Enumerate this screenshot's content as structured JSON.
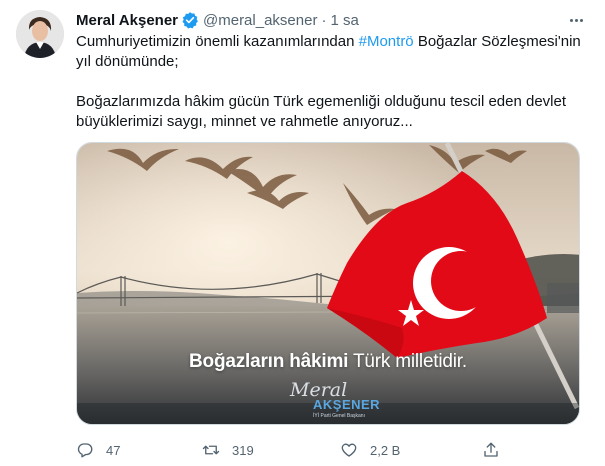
{
  "tweet": {
    "author_name": "Meral Akşener",
    "handle": "@meral_aksener",
    "separator": "·",
    "time": "1 sa",
    "text_before_hashtag": "Cumhuriyetimizin önemli kazanımlarından ",
    "hashtag": "#Montrö",
    "text_after_hashtag": " Boğazlar Sözleşmesi'nin yıl dönümünde;",
    "paragraph2": "Boğazlarımızda hâkim gücün Türk egemenliği olduğunu tescil eden devlet büyüklerimizi saygı, minnet ve rahmetle anıyoruz..."
  },
  "media": {
    "caption_bold": "Boğazların hâkimi",
    "caption_rest": " Türk milletidir.",
    "logo_script": "Meral",
    "logo_name": "AKŞENER",
    "logo_sub": "İYİ Parti Genel Başkanı"
  },
  "actions": {
    "reply_count": "47",
    "retweet_count": "319",
    "like_count": "2,2 B"
  },
  "colors": {
    "accent": "#1d9bf0",
    "text": "#0f1419",
    "muted": "#536471",
    "flag_red": "#e30a17"
  },
  "icons": {
    "verified": "verified-badge-icon",
    "more": "more-dots-icon",
    "reply": "reply-icon",
    "retweet": "retweet-icon",
    "like": "heart-icon",
    "share": "share-icon"
  }
}
